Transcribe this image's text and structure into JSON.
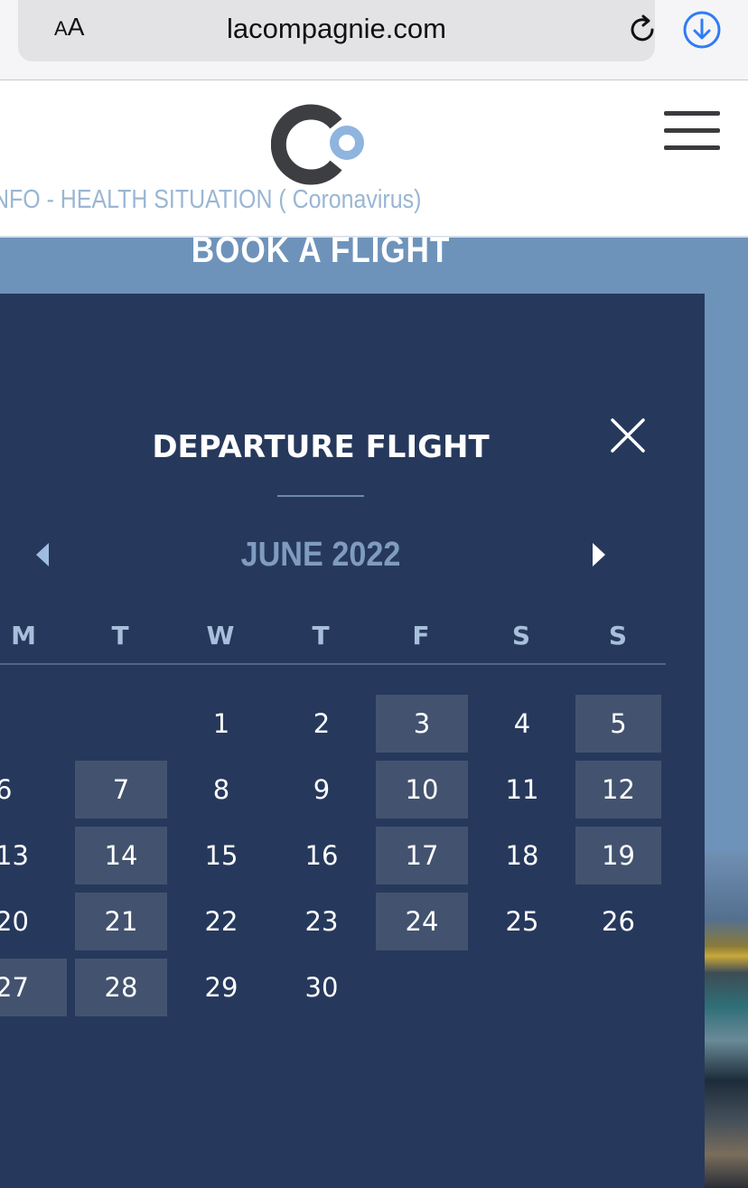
{
  "browser": {
    "text_size_label_small": "A",
    "text_size_label_large": "A",
    "url": "lacompagnie.com"
  },
  "site": {
    "health_banner": "NFO - HEALTH SITUATION ( Coronavirus)",
    "section_title": "BOOK A FLIGHT"
  },
  "calendar": {
    "title": "DEPARTURE FLIGHT",
    "month": "JUNE 2022",
    "weekdays": [
      "M",
      "T",
      "W",
      "T",
      "F",
      "S",
      "S"
    ],
    "weeks": [
      [
        {
          "day": "",
          "available": false
        },
        {
          "day": "",
          "available": false
        },
        {
          "day": "1",
          "available": false
        },
        {
          "day": "2",
          "available": false
        },
        {
          "day": "3",
          "available": true
        },
        {
          "day": "4",
          "available": false
        },
        {
          "day": "5",
          "available": true
        }
      ],
      [
        {
          "day": "6",
          "available": false
        },
        {
          "day": "7",
          "available": true
        },
        {
          "day": "8",
          "available": false
        },
        {
          "day": "9",
          "available": false
        },
        {
          "day": "10",
          "available": true
        },
        {
          "day": "11",
          "available": false
        },
        {
          "day": "12",
          "available": true
        }
      ],
      [
        {
          "day": "13",
          "available": false
        },
        {
          "day": "14",
          "available": true
        },
        {
          "day": "15",
          "available": false
        },
        {
          "day": "16",
          "available": false
        },
        {
          "day": "17",
          "available": true
        },
        {
          "day": "18",
          "available": false
        },
        {
          "day": "19",
          "available": true
        }
      ],
      [
        {
          "day": "20",
          "available": false
        },
        {
          "day": "21",
          "available": true
        },
        {
          "day": "22",
          "available": false
        },
        {
          "day": "23",
          "available": false
        },
        {
          "day": "24",
          "available": true
        },
        {
          "day": "25",
          "available": false
        },
        {
          "day": "26",
          "available": false
        }
      ],
      [
        {
          "day": "27",
          "available": true
        },
        {
          "day": "28",
          "available": true
        },
        {
          "day": "29",
          "available": false
        },
        {
          "day": "30",
          "available": false
        },
        {
          "day": "",
          "available": false
        },
        {
          "day": "",
          "available": false
        },
        {
          "day": "",
          "available": false
        }
      ]
    ]
  },
  "colors": {
    "panel_bg": "#26395c",
    "available_day_bg": "#43536f",
    "band_bg": "#6e93bb",
    "accent_light_blue": "#9ab6d4"
  },
  "icons": [
    "reload-icon",
    "download-icon",
    "menu-icon",
    "close-icon",
    "prev-month-icon",
    "next-month-icon"
  ]
}
